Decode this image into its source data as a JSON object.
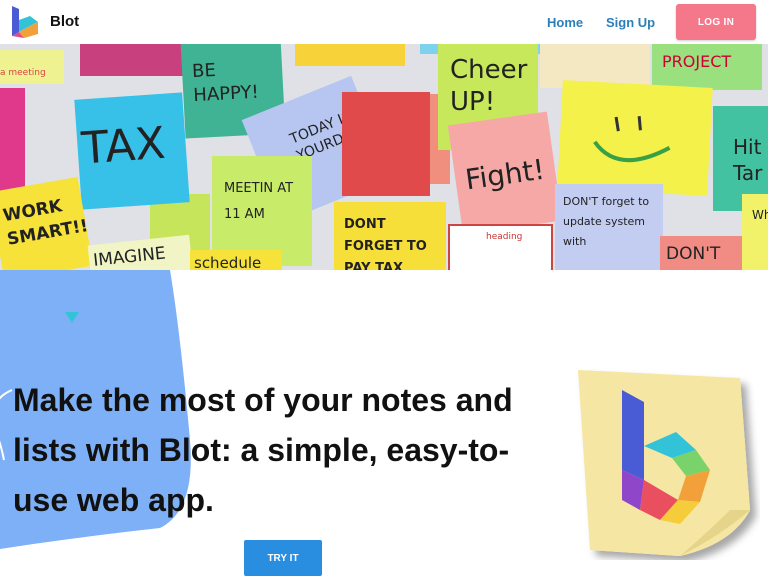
{
  "nav": {
    "brand": "Blot",
    "links": [
      {
        "label": "Home"
      },
      {
        "label": "Sign Up"
      }
    ],
    "login": "LOG IN"
  },
  "hero_notes": [
    "BE HAPPY!",
    "TAX",
    "TODAY IS YOURDAY!",
    "Cheer UP!",
    "PROJECT",
    "Fight!",
    "Hit Tar",
    "WORK SMART!!",
    "MEETIN AT 11 AM",
    "DONT FORGET TO PAY TAX",
    "DON'T forget to update system with",
    "IMAGINE",
    "schedule",
    "DON'T",
    "Wh",
    "a meeting",
    "heading"
  ],
  "hero": {
    "headline": "Make the most of your notes and lists with Blot: a simple, easy-to-use web app.",
    "cta": "TRY IT"
  },
  "colors": {
    "accent_pink": "#f4778a",
    "link_blue": "#2c7fb8",
    "cta_blue": "#2a8ee0",
    "blob_blue": "#7eb0f7",
    "sticky_yellow": "#f5e7a3"
  }
}
